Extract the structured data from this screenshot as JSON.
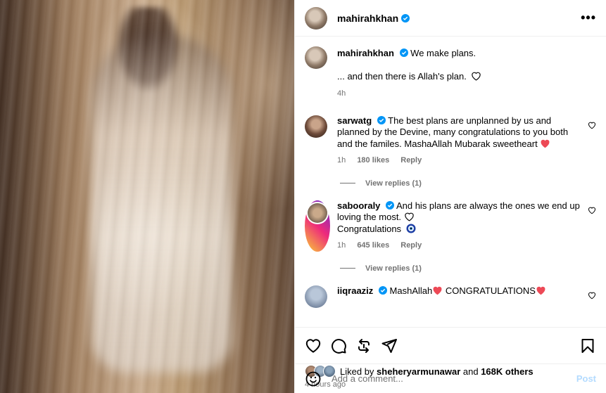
{
  "header": {
    "username": "mahirahkhan",
    "more_label": "•••"
  },
  "caption": {
    "username": "mahirahkhan",
    "line1": "We make plans.",
    "line2": "... and then there is Allah's plan.",
    "time": "4h"
  },
  "comments": [
    {
      "username": "sarwatg",
      "text": "The best plans are unplanned by us and planned by the Devine, many congratulations to you both and the familes. MashaAllah Mubarak sweetheart",
      "time": "1h",
      "likes": "180 likes",
      "reply_label": "Reply",
      "view_replies": "View replies (1)"
    },
    {
      "username": "sabooraly",
      "text": "And his plans are always the ones we end up loving the most.",
      "text2": "Congratulations",
      "time": "1h",
      "likes": "645 likes",
      "reply_label": "Reply",
      "view_replies": "View replies (1)"
    },
    {
      "username": "iiqraaziz",
      "text_a": "MashAllah",
      "text_b": " CONGRATULATIONS"
    }
  ],
  "likes": {
    "prefix": "Liked by ",
    "user": "sheheryarmunawar",
    "middle": " and ",
    "count": "168K others"
  },
  "time_ago": "4 hours ago",
  "add_comment": {
    "placeholder": "Add a comment...",
    "post_label": "Post"
  },
  "colors": {
    "verified": "#0095f6",
    "heart_red": "#ed4956",
    "post_button": "#b3dbff",
    "muted": "#737373"
  }
}
